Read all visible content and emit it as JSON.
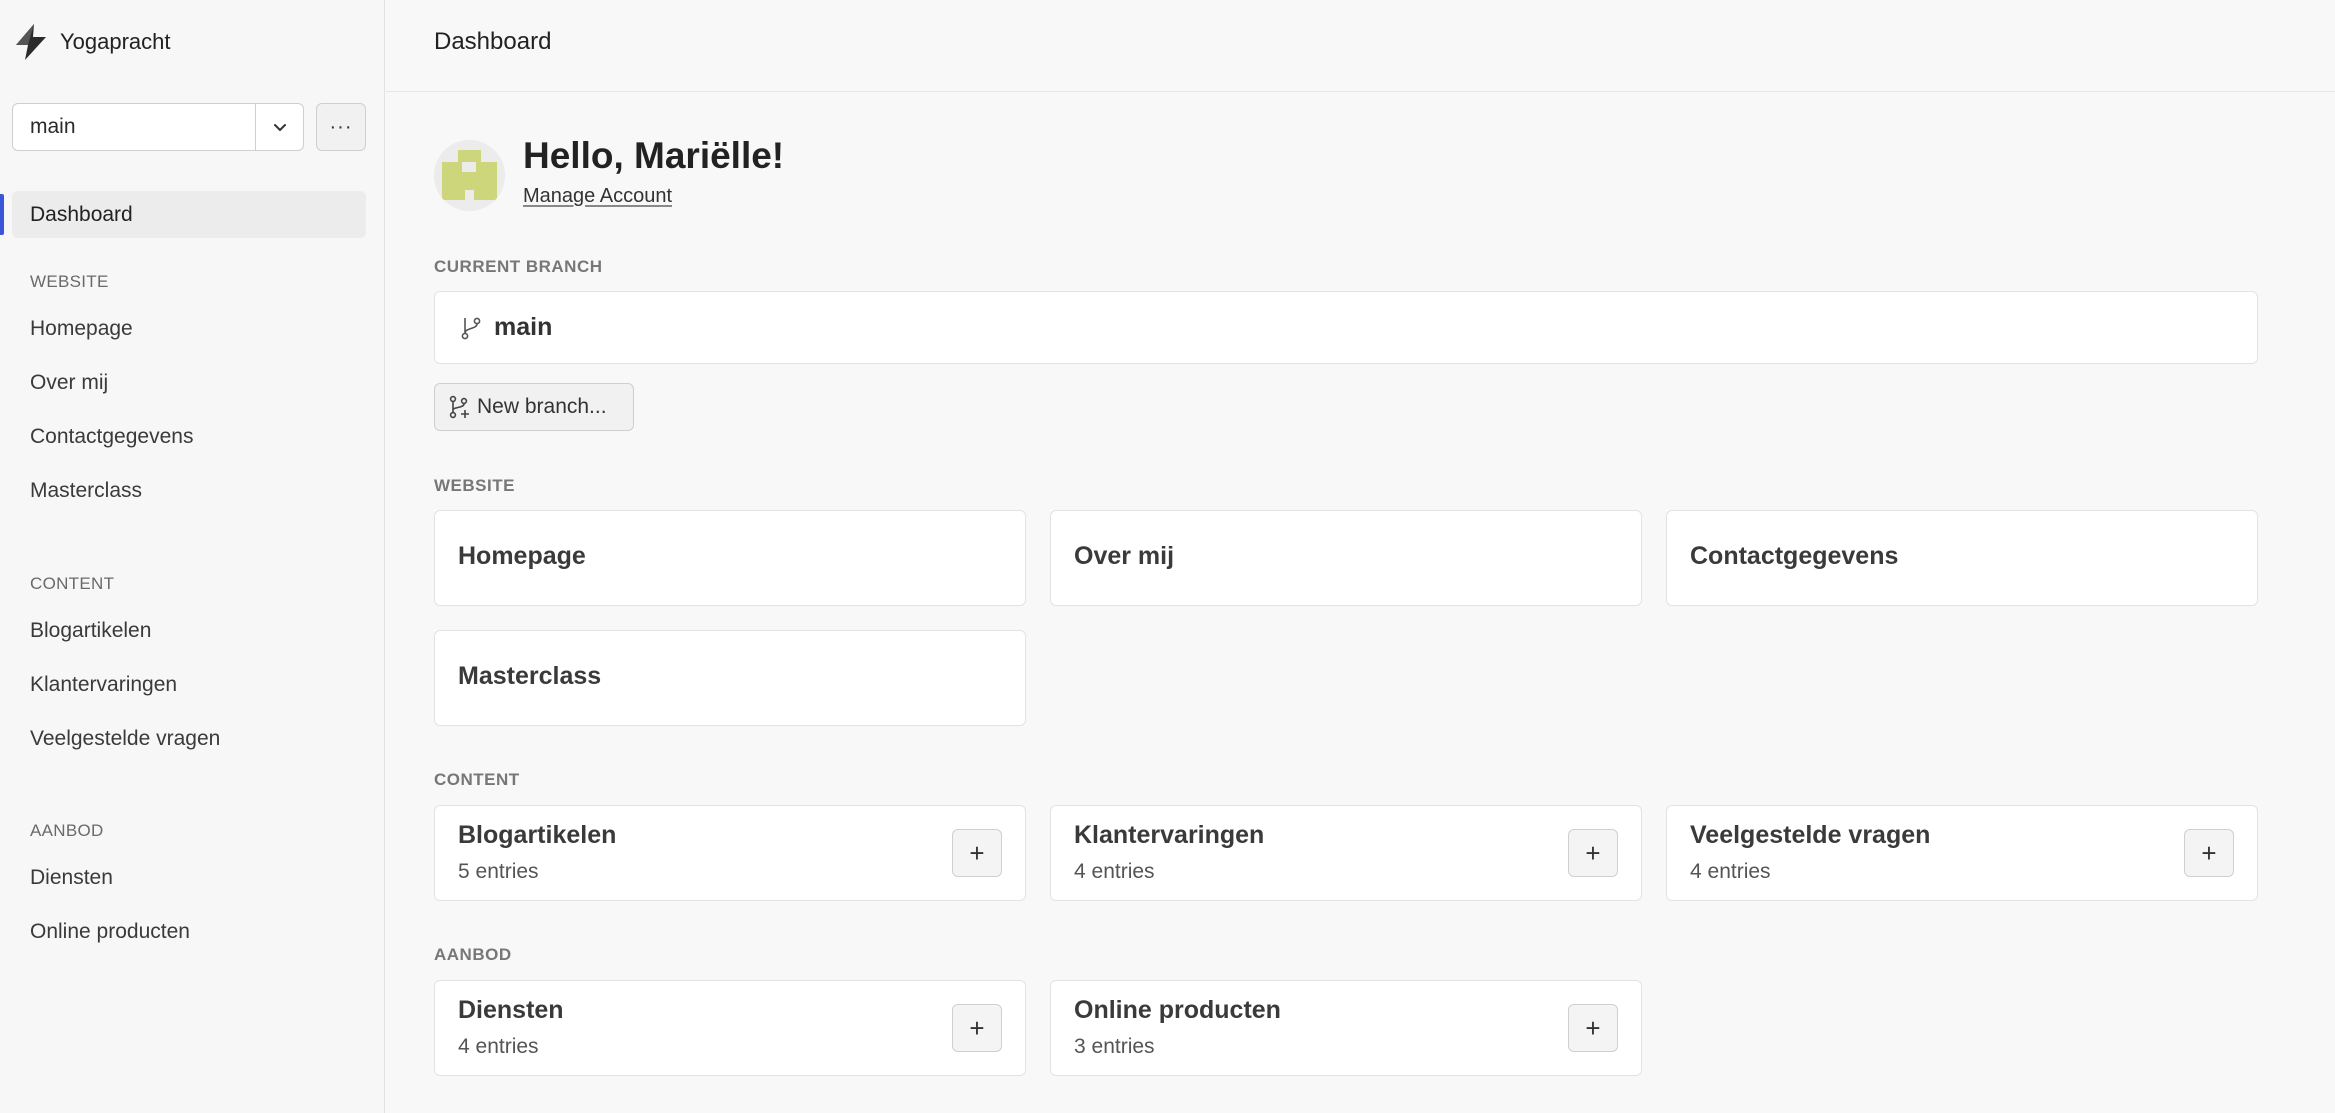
{
  "app": {
    "name": "Yogapracht"
  },
  "sidebar": {
    "branch_select": {
      "value": "main"
    },
    "more_label": "···",
    "active_item": "Dashboard",
    "sections": [
      {
        "label": "WEBSITE",
        "items": [
          "Homepage",
          "Over mij",
          "Contactgegevens",
          "Masterclass"
        ]
      },
      {
        "label": "CONTENT",
        "items": [
          "Blogartikelen",
          "Klantervaringen",
          "Veelgestelde vragen"
        ]
      },
      {
        "label": "AANBOD",
        "items": [
          "Diensten",
          "Online producten"
        ]
      }
    ]
  },
  "header": {
    "title": "Dashboard"
  },
  "welcome": {
    "greeting": "Hello, Mariëlle!",
    "manage_link": "Manage Account"
  },
  "current_branch": {
    "label": "CURRENT BRANCH",
    "name": "main",
    "new_branch_label": "New branch..."
  },
  "website": {
    "label": "WEBSITE",
    "cards": [
      "Homepage",
      "Over mij",
      "Contactgegevens",
      "Masterclass"
    ]
  },
  "content": {
    "label": "CONTENT",
    "cards": [
      {
        "title": "Blogartikelen",
        "count": "5 entries"
      },
      {
        "title": "Klantervaringen",
        "count": "4 entries"
      },
      {
        "title": "Veelgestelde vragen",
        "count": "4 entries"
      }
    ]
  },
  "aanbod": {
    "label": "AANBOD",
    "cards": [
      {
        "title": "Diensten",
        "count": "4 entries"
      },
      {
        "title": "Online producten",
        "count": "3 entries"
      }
    ]
  },
  "add_label": "+",
  "colors": {
    "accent": "#3b55d9",
    "avatar": "#cdd67a"
  },
  "icons": [
    "logo-icon",
    "chevron-down-icon",
    "more-icon",
    "branch-icon",
    "new-branch-icon",
    "plus-icon"
  ]
}
